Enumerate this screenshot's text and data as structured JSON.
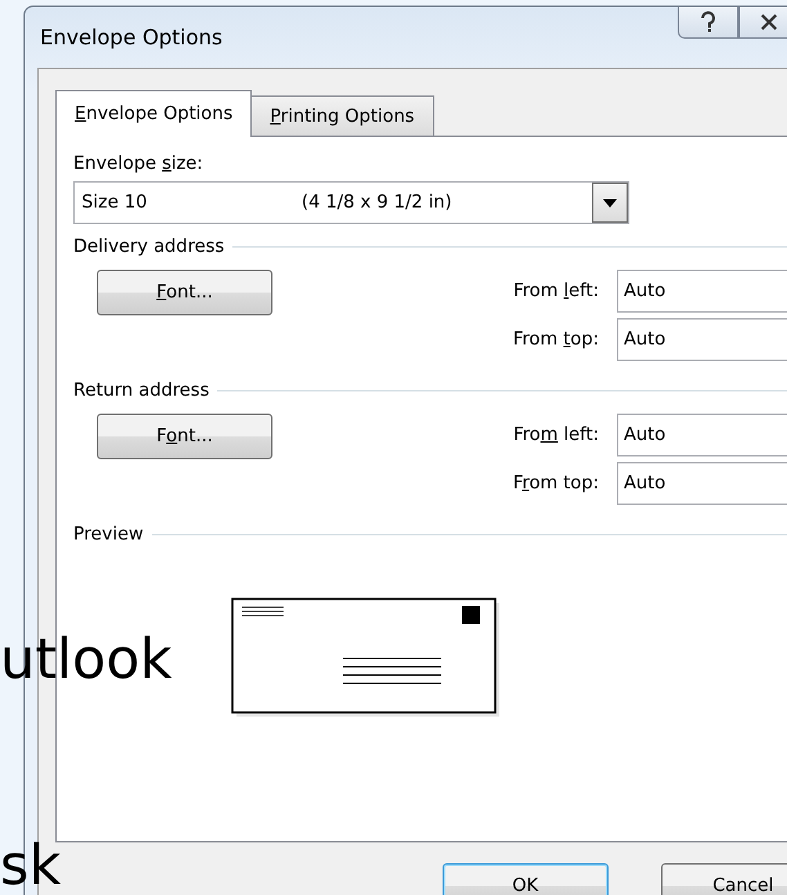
{
  "desktop_texts": [
    "utlook",
    "sk"
  ],
  "window": {
    "title": "Envelope Options"
  },
  "tabs": [
    {
      "key": "E",
      "post": "nvelope Options",
      "selected": true
    },
    {
      "key": "P",
      "post": "rinting Options",
      "selected": false
    }
  ],
  "envelope_size": {
    "pre": "Envelope ",
    "key": "s",
    "post": "ize:",
    "value": "Size 10",
    "dimensions": "(4 1/8 x 9 1/2 in)"
  },
  "sections": [
    {
      "title": "Delivery address",
      "font_button": {
        "key": "F",
        "post": "ont..."
      },
      "fields": [
        {
          "pre": "From ",
          "key": "l",
          "post": "eft:",
          "value": "Auto"
        },
        {
          "pre": "From ",
          "key": "t",
          "post": "op:",
          "value": "Auto"
        }
      ]
    },
    {
      "title": "Return address",
      "font_button": {
        "pre": "F",
        "key": "o",
        "post": "nt..."
      },
      "fields": [
        {
          "pre": "Fro",
          "key": "m",
          "post": " left:",
          "value": "Auto"
        },
        {
          "pre": "F",
          "key": "r",
          "post": "om top:",
          "value": "Auto"
        }
      ]
    }
  ],
  "preview": {
    "title": "Preview"
  },
  "buttons": [
    "OK",
    "Cancel"
  ]
}
